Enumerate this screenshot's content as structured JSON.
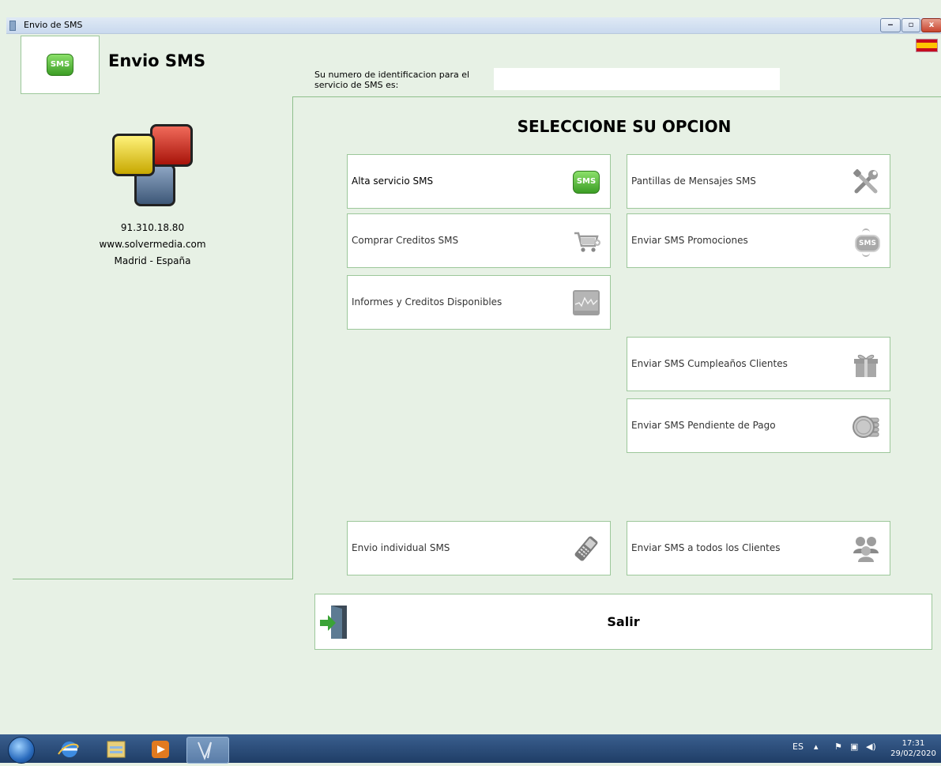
{
  "window": {
    "title": "Envio de SMS",
    "minimize_label": "‒",
    "maximize_label": "▫",
    "close_label": "x"
  },
  "header": {
    "app_title": "Envio SMS",
    "logo_badge": "SMS",
    "id_label": "Su numero de identificacion para el servicio de SMS es:",
    "id_value": ""
  },
  "company": {
    "phone": "91.310.18.80",
    "website": "www.solvermedia.com",
    "location": "Madrid - España"
  },
  "main": {
    "title": "SELECCIONE SU OPCION",
    "options": {
      "alta": {
        "label": "Alta servicio SMS",
        "icon": "sms-bubble-icon",
        "badge": "SMS"
      },
      "comprar": {
        "label": "Comprar Creditos SMS",
        "icon": "shopping-cart-icon"
      },
      "informes": {
        "label": "Informes y Creditos Disponibles",
        "icon": "report-graph-icon"
      },
      "plantillas": {
        "label": "Pantillas de Mensajes SMS",
        "icon": "tools-icon"
      },
      "promociones": {
        "label": "Enviar SMS Promociones",
        "icon": "sms-broadcast-icon",
        "badge": "SMS"
      },
      "cumpleanos": {
        "label": "Enviar SMS Cumpleaños Clientes",
        "icon": "gift-icon"
      },
      "pendiente": {
        "label": "Enviar SMS Pendiente de Pago",
        "icon": "coins-icon"
      },
      "individual": {
        "label": "Envio individual SMS",
        "icon": "mobile-phone-icon"
      },
      "todos": {
        "label": "Enviar SMS a todos los Clientes",
        "icon": "users-group-icon"
      }
    },
    "exit_label": "Salir"
  },
  "taskbar": {
    "language": "ES",
    "time": "17:31",
    "date": "29/02/2020"
  },
  "colors": {
    "background": "#e7f1e5",
    "border": "#9cc79a",
    "sms_green": "#3c9d25"
  }
}
